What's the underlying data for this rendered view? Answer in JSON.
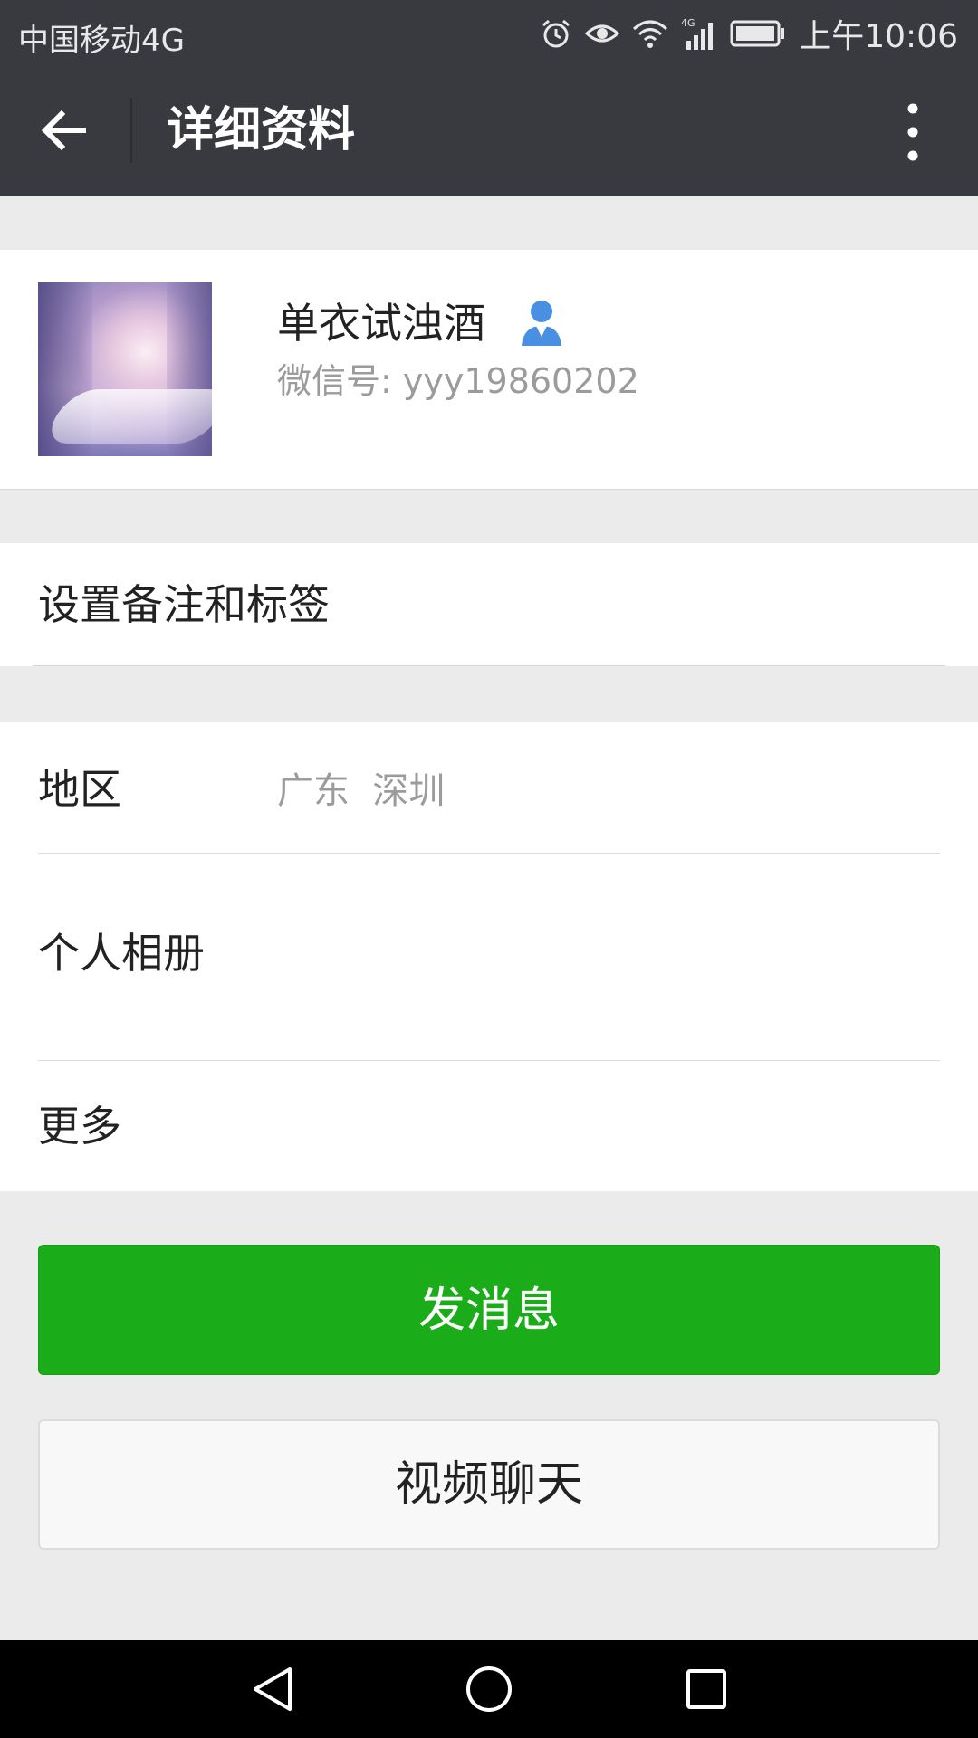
{
  "status_bar": {
    "carrier": "中国移动4G",
    "time": "上午10:06",
    "icons": [
      "alarm-icon",
      "eye-icon",
      "wifi-icon",
      "4g-signal-icon",
      "battery-icon"
    ],
    "network_label": "4G"
  },
  "app_bar": {
    "title": "详细资料",
    "icons": [
      "back-arrow-icon",
      "more-vertical-icon"
    ],
    "background": "#393a3f"
  },
  "profile": {
    "name": "单衣试浊酒",
    "wechat_id": "微信号: yyy19860202",
    "icons": [
      "person-icon"
    ],
    "accent": "#4a90e2"
  },
  "remark": {
    "label": "设置备注和标签"
  },
  "info": {
    "region_label": "地区",
    "region_value": "广东  深圳",
    "album_label": "个人相册",
    "more_label": "更多"
  },
  "actions": {
    "send_message": "发消息",
    "video_chat": "视频聊天",
    "primary_color": "#1aad19"
  },
  "nav_bar": {
    "icons": [
      "back-triangle-icon",
      "home-circle-icon",
      "recents-square-icon"
    ]
  }
}
